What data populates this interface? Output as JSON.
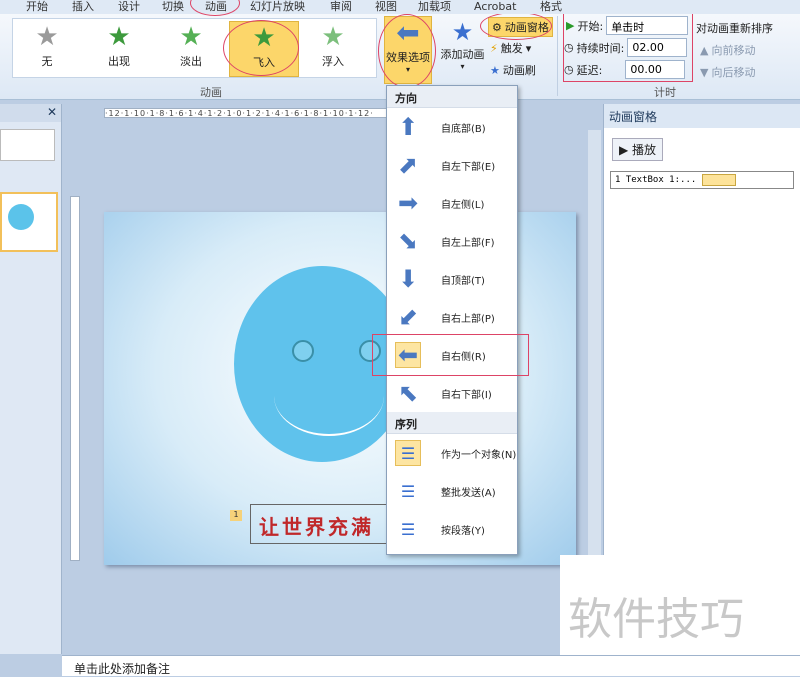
{
  "tabs": [
    "开始",
    "插入",
    "设计",
    "切换",
    "动画",
    "幻灯片放映",
    "审阅",
    "视图",
    "加载项",
    "Acrobat",
    "格式"
  ],
  "gallery": [
    {
      "label": "无",
      "color": "#9a9a9a"
    },
    {
      "label": "出现",
      "color": "#3d9a3d"
    },
    {
      "label": "淡出",
      "color": "#55b055"
    },
    {
      "label": "飞入",
      "color": "#3d9a3d"
    },
    {
      "label": "浮入",
      "color": "#7cbf7c"
    }
  ],
  "ribbon": {
    "effect_options": "效果选项",
    "add_animation": "添加动画",
    "animation_pane": "动画窗格",
    "trigger": "触发",
    "animation_painter": "动画刷",
    "group_animation": "动画",
    "group_timing": "计时",
    "start_label": "开始:",
    "start_value": "单击时",
    "duration_label": "持续时间:",
    "duration_value": "02.00",
    "delay_label": "延迟:",
    "delay_value": "00.00",
    "reorder": "对动画重新排序",
    "move_earlier": "向前移动",
    "move_later": "向后移动"
  },
  "ruler": "·12·1·10·1·8·1·6·1·4·1·2·1·0·1·2·1·4·1·6·1·8·1·10·1·12·",
  "menu": {
    "direction_header": "方向",
    "directions": [
      {
        "label": "自底部(B)",
        "glyph": "⬆"
      },
      {
        "label": "自左下部(E)",
        "glyph": "⬈"
      },
      {
        "label": "自左侧(L)",
        "glyph": "➡"
      },
      {
        "label": "自左上部(F)",
        "glyph": "⬊"
      },
      {
        "label": "自顶部(T)",
        "glyph": "⬇"
      },
      {
        "label": "自右上部(P)",
        "glyph": "⬋"
      },
      {
        "label": "自右侧(R)",
        "glyph": "⬅"
      },
      {
        "label": "自右下部(I)",
        "glyph": "⬉"
      }
    ],
    "sequence_header": "序列",
    "sequences": [
      "作为一个对象(N)",
      "整批发送(A)",
      "按段落(Y)"
    ]
  },
  "slide": {
    "text": "让世界充满",
    "badge": "1"
  },
  "pane": {
    "title": "动画窗格",
    "play": "播放",
    "item": "1   TextBox 1:..."
  },
  "notes": "单击此处添加备注",
  "watermark": "软件技巧"
}
